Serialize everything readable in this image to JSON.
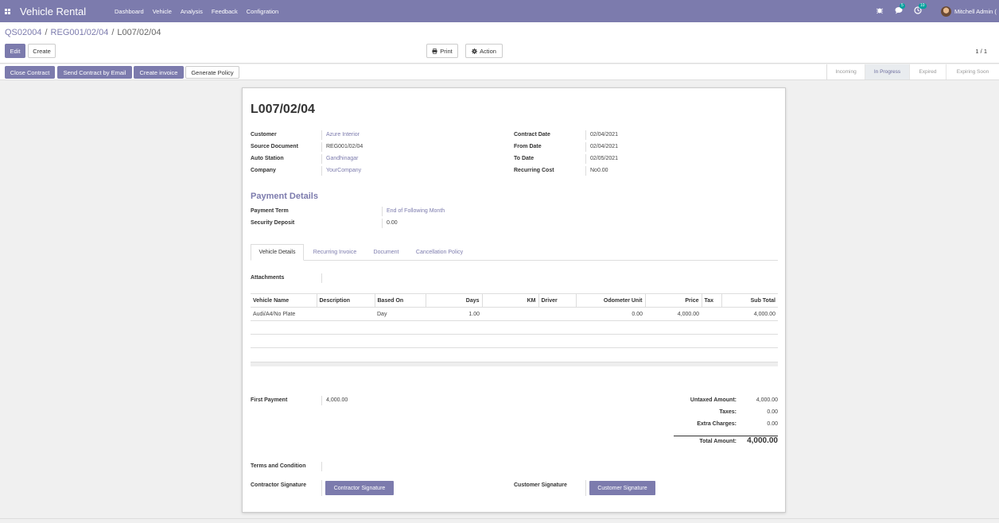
{
  "navbar": {
    "app_title": "Vehicle Rental",
    "menu": [
      "Dashboard",
      "Vehicle",
      "Analysis",
      "Feedback",
      "Configration"
    ],
    "messages_count": "5",
    "activities_count": "10",
    "user_name": "Mitchell Admin ("
  },
  "breadcrumb": [
    "QS02004",
    "REG001/02/04",
    "L007/02/04"
  ],
  "buttons": {
    "edit": "Edit",
    "create": "Create",
    "print": "Print",
    "action": "Action"
  },
  "pager": "1 / 1",
  "statusbar": {
    "buttons": [
      "Close Contract",
      "Send Contract by Email",
      "Create invoice",
      "Generate Policy"
    ],
    "stages": [
      "Incoming",
      "In Progress",
      "Expired",
      "Expiring Soon"
    ],
    "current_stage": "In Progress"
  },
  "record": {
    "name": "L007/02/04",
    "left_fields": [
      {
        "label": "Customer",
        "value": "Azure Interior"
      },
      {
        "label": "Source Document",
        "value": "REG001/02/04"
      },
      {
        "label": "Auto Station",
        "value": "Gandhinagar"
      },
      {
        "label": "Company",
        "value": "YourCompany"
      }
    ],
    "right_fields": [
      {
        "label": "Contract Date",
        "value": "02/04/2021"
      },
      {
        "label": "From Date",
        "value": "02/04/2021"
      },
      {
        "label": "To Date",
        "value": "02/05/2021"
      },
      {
        "label": "Recurring Cost",
        "value": "No0.00"
      }
    ],
    "payment_section_title": "Payment Details",
    "payment_fields": [
      {
        "label": "Payment Term",
        "value": "End of Following Month"
      },
      {
        "label": "Security Deposit",
        "value": "0.00"
      }
    ]
  },
  "tabs": [
    "Vehicle Details",
    "Recurring Invoice",
    "Document",
    "Cancellation Policy"
  ],
  "attachments_label": "Attachments",
  "lines": {
    "columns": [
      "Vehicle Name",
      "Description",
      "Based On",
      "Days",
      "KM",
      "Driver",
      "Odometer Unit",
      "Price",
      "Tax",
      "Sub Total"
    ],
    "rows": [
      {
        "vehicle": "Audi/A4/No Plate",
        "description": "",
        "based_on": "Day",
        "days": "1.00",
        "km": "",
        "driver": "",
        "odometer": "0.00",
        "price": "4,000.00",
        "tax": "",
        "subtotal": "4,000.00"
      }
    ]
  },
  "first_payment": {
    "label": "First Payment",
    "value": "4,000.00"
  },
  "totals": {
    "untaxed_label": "Untaxed Amount:",
    "untaxed": "4,000.00",
    "taxes_label": "Taxes:",
    "taxes": "0.00",
    "extra_label": "Extra Charges:",
    "extra": "0.00",
    "total_label": "Total Amount:",
    "total": "4,000.00"
  },
  "terms_label": "Terms and Condition",
  "signatures": {
    "contractor_label": "Contractor Signature",
    "contractor_button": "Contractor Signature",
    "customer_label": "Customer Signature",
    "customer_button": "Customer Signature"
  },
  "colors": {
    "brand": "#7c7bad",
    "badge": "#00a09d"
  }
}
